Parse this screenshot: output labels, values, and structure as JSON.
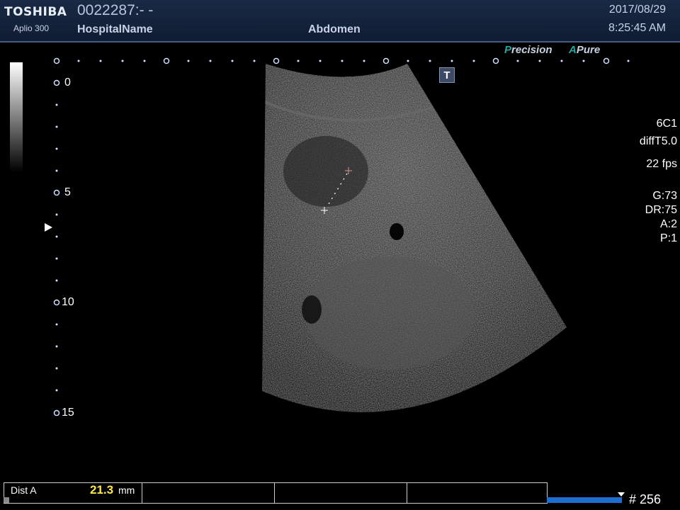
{
  "header": {
    "brand": "TOSHIBA",
    "model": "Aplio 300",
    "patient_id": "0022287:- -",
    "hospital": "HospitalName",
    "exam": "Abdomen",
    "date": "2017/08/29",
    "time": "8:25:45 AM"
  },
  "mode": {
    "precision_first": "P",
    "precision_rest": "recision",
    "apure_first": "A",
    "apure_rest": "Pure",
    "accent_color": "#27a6a0"
  },
  "annotation_tool": {
    "label": "T"
  },
  "depth_scale": {
    "labels": [
      "0",
      "5",
      "10",
      "15"
    ]
  },
  "probe": {
    "transducer": "6C1",
    "preset": "diffT5.0",
    "frame_rate": "22 fps",
    "gain": "G:73",
    "dynamic_range": "DR:75",
    "a": "A:2",
    "p": "P:1"
  },
  "measurement": {
    "label": "Dist A",
    "value": "21.3",
    "unit": "mm",
    "value_color": "#ffe84a"
  },
  "cine": {
    "frame_count": "# 256"
  }
}
